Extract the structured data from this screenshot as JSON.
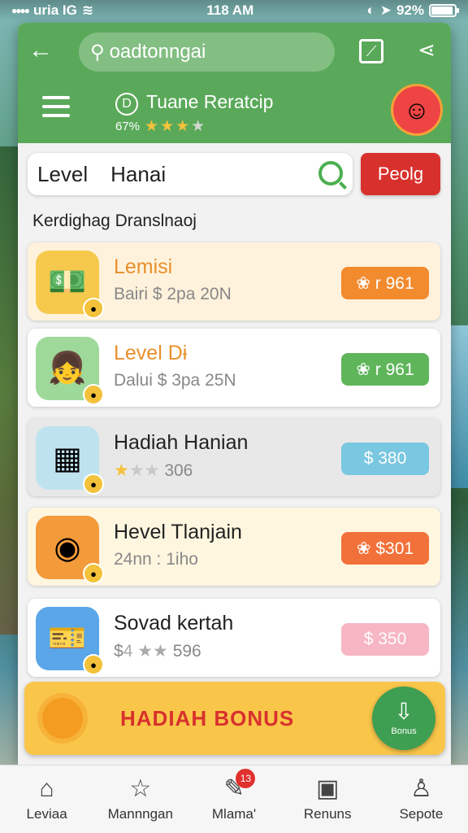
{
  "status_bar": {
    "carrier": "uria IG",
    "time": "118 AM",
    "battery": "92%",
    "battery_level": 0.92
  },
  "header": {
    "search_text": "oadtonngai",
    "app_title": "Tuane Reratcip",
    "app_badge": "D",
    "app_sub": "67%",
    "rating_stars": 3,
    "rating_max": 4
  },
  "search": {
    "label": "Level",
    "value": "Hanai"
  },
  "peolg_button": "Peolg",
  "section_title": "Kerdighag Dranslnaoj",
  "colors": {
    "header": "#5aa95a",
    "peolg": "#d8312d",
    "bonus": "#f9c64a"
  },
  "items": [
    {
      "title": "Lemisi",
      "subtitle": "Bairi $ 2pa 20N",
      "price": "❀ r 961",
      "price_color": "#f28a2e",
      "title_color": "#e8902a",
      "bg": "#fff2dc",
      "icon": "money-icon",
      "thumb_bg": "#f6c94c"
    },
    {
      "title": "Level Dɨ",
      "subtitle": "Dalui $ 3pa 25N",
      "price": "❀ r 961",
      "price_color": "#5fb65a",
      "title_color": "#e8902a",
      "bg": "#ffffff",
      "icon": "girl-avatar-icon",
      "thumb_bg": "#9ed99a"
    },
    {
      "title": "Hadiah Hanian",
      "subtitle": "306",
      "price": "$ 380",
      "price_color": "#79c7e0",
      "title_color": "#222222",
      "bg": "#e8e8e8",
      "icon": "calendar-icon",
      "thumb_bg": "#bfe3ee"
    },
    {
      "title": "Hevel Tlanjain",
      "subtitle": "24nn : 1iho",
      "price": "❀ $301",
      "price_color": "#f2713a",
      "title_color": "#222222",
      "bg": "#fff6e0",
      "icon": "camera-icon",
      "thumb_bg": "#f39a3a"
    },
    {
      "title": "Sovad kertah",
      "subtitle": "596",
      "price": "$ 350",
      "price_color": "#f7b6c4",
      "title_color": "#222222",
      "bg": "#ffffff",
      "icon": "ticket-icon",
      "thumb_bg": "#5aa6e8"
    }
  ],
  "bonus": {
    "label": "HADIAH BONUS",
    "fab_label": "Bonus"
  },
  "nav": [
    {
      "label": "Leviaa",
      "icon": "home-icon"
    },
    {
      "label": "Mannngan",
      "icon": "star-icon"
    },
    {
      "label": "Mlama'",
      "icon": "edit-icon",
      "badge": "13"
    },
    {
      "label": "Renuns",
      "icon": "briefcase-icon"
    },
    {
      "label": "Sepote",
      "icon": "profile-icon"
    }
  ]
}
